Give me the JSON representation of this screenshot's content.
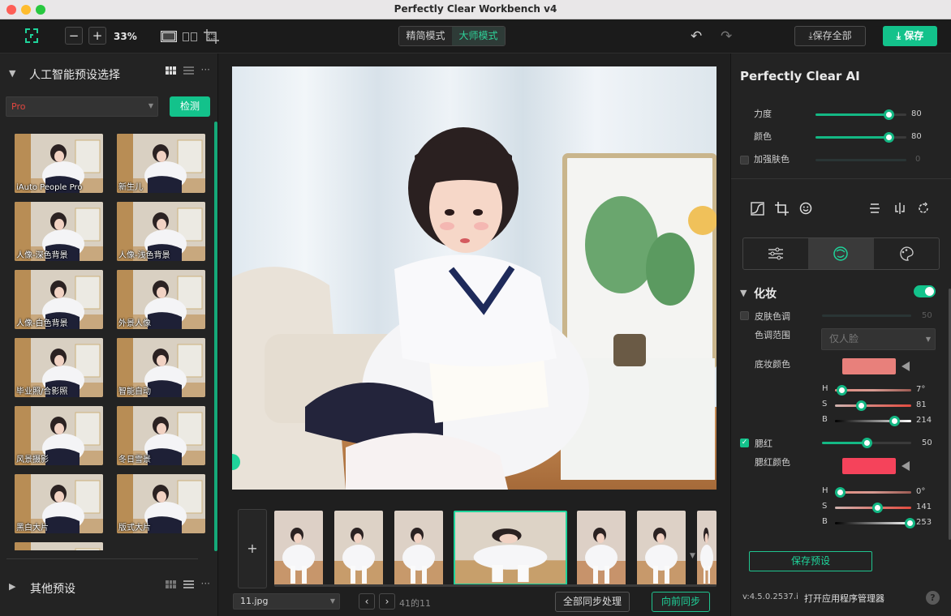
{
  "window": {
    "title": "Perfectly Clear Workbench v4"
  },
  "toolbar": {
    "zoom_out": "−",
    "zoom_in": "+",
    "zoom_level": "33%",
    "modes": [
      {
        "label": "精简模式"
      },
      {
        "label": "大师模式"
      }
    ],
    "undo": "↶",
    "redo": "↷",
    "save_all": "保存全部",
    "save": "保存"
  },
  "left": {
    "section_title": "人工智能预设选择",
    "preset_select": "Pro",
    "detect": "检测",
    "presets": [
      {
        "label": "iAuto People Pro"
      },
      {
        "label": "新生儿"
      },
      {
        "label": "人像-深色背景"
      },
      {
        "label": "人像-浅色背景"
      },
      {
        "label": "人像-白色背景"
      },
      {
        "label": "外景人像"
      },
      {
        "label": "毕业照/合影照"
      },
      {
        "label": "智能自动"
      },
      {
        "label": "风景摄影"
      },
      {
        "label": "冬日雪景"
      },
      {
        "label": "黑白大片"
      },
      {
        "label": "版式大片"
      }
    ],
    "other_presets": "其他预设",
    "more": "···"
  },
  "center": {
    "add": "+",
    "file": "11.jpg",
    "prev": "‹",
    "next": "›",
    "counter": "41的11",
    "sync_all": "全部同步处理",
    "sync_forward": "向前同步"
  },
  "right": {
    "title": "Perfectly Clear AI",
    "strength": {
      "label": "力度",
      "value": "80",
      "pct": 0.8
    },
    "color": {
      "label": "颜色",
      "value": "80",
      "pct": 0.8
    },
    "skin": {
      "label": "加强肤色",
      "value": "0",
      "pct": 0
    },
    "makeup": {
      "title": "化妆",
      "skin_tone": {
        "label": "皮肤色调",
        "value": "50"
      },
      "tone_range": {
        "label": "色调范围",
        "value": "仅人脸"
      },
      "foundation": {
        "label": "底妆颜色",
        "color": "#e8807b",
        "h": "7°",
        "s": "81",
        "b": "214",
        "h_pct": 0.08,
        "s_pct": 0.34,
        "b_pct": 0.78
      },
      "blush": {
        "label": "腮红",
        "value": "50",
        "pct": 0.5
      },
      "blush_color": {
        "label": "腮红颜色",
        "color": "#f5435b",
        "h": "0°",
        "s": "141",
        "b": "253",
        "h_pct": 0.06,
        "s_pct": 0.55,
        "b_pct": 0.98
      }
    },
    "hsb_labels": {
      "h": "H",
      "s": "S",
      "b": "B"
    },
    "save_preset": "保存预设",
    "version": "v:4.5.0.2537.i",
    "app_manager": "打开应用程序管理器",
    "help": "?"
  },
  "colors": {
    "accent": "#13c28b",
    "brand_text": "#1fd39a"
  }
}
